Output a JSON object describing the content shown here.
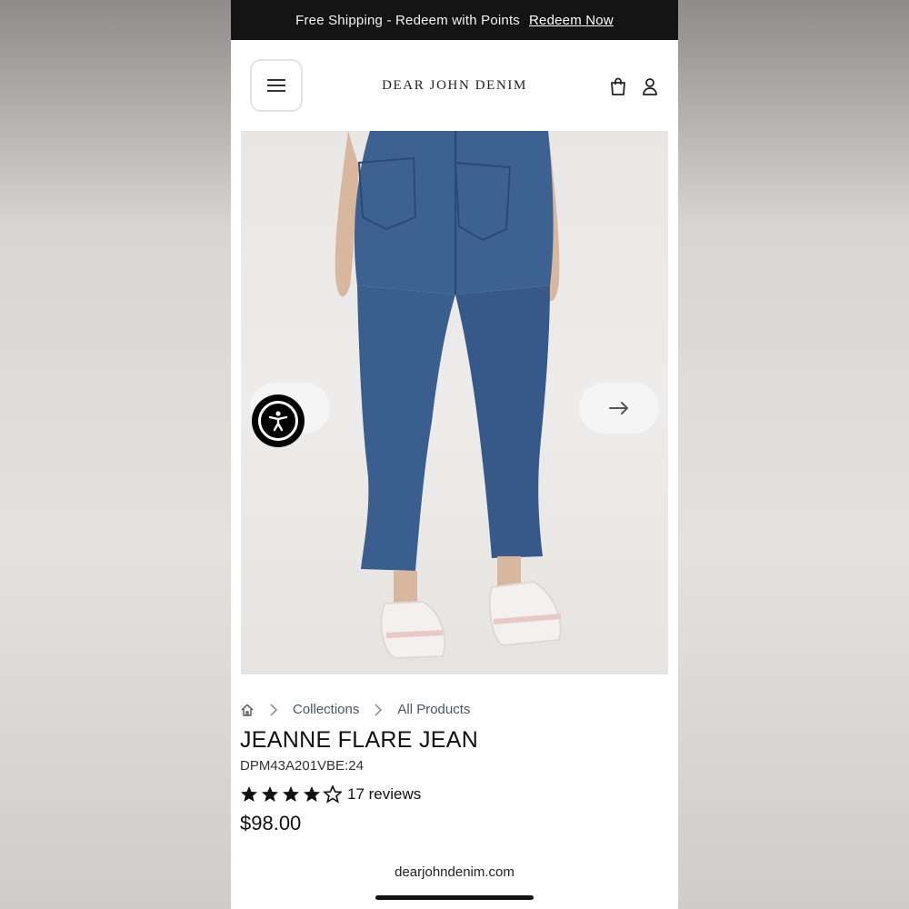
{
  "promo": {
    "text": "Free Shipping - Redeem with Points",
    "link": "Redeem Now"
  },
  "header": {
    "brand": "DEAR JOHN DENIM",
    "icons": [
      "menu-icon",
      "shopping-bag-icon",
      "user-icon"
    ]
  },
  "gallery": {
    "image_alt": "Back view of cropped flare jeans with white sneakers",
    "prev_icon": "arrow-left-icon",
    "next_icon": "arrow-right-icon",
    "accessibility_icon": "accessibility-icon"
  },
  "breadcrumb": {
    "home_icon": "home-icon",
    "items": [
      "Collections",
      "All Products"
    ]
  },
  "product": {
    "title": "JEANNE FLARE JEAN",
    "sku": "DPM43A201VBE:24",
    "rating": 4.5,
    "reviews": "17 reviews",
    "price": "$98.00"
  },
  "browser": {
    "url": "dearjohndenim.com"
  },
  "colors": {
    "promo_bg": "#141414",
    "text": "#111111",
    "breadcrumb": "#4a5563",
    "denim": "#3b5f8f"
  }
}
